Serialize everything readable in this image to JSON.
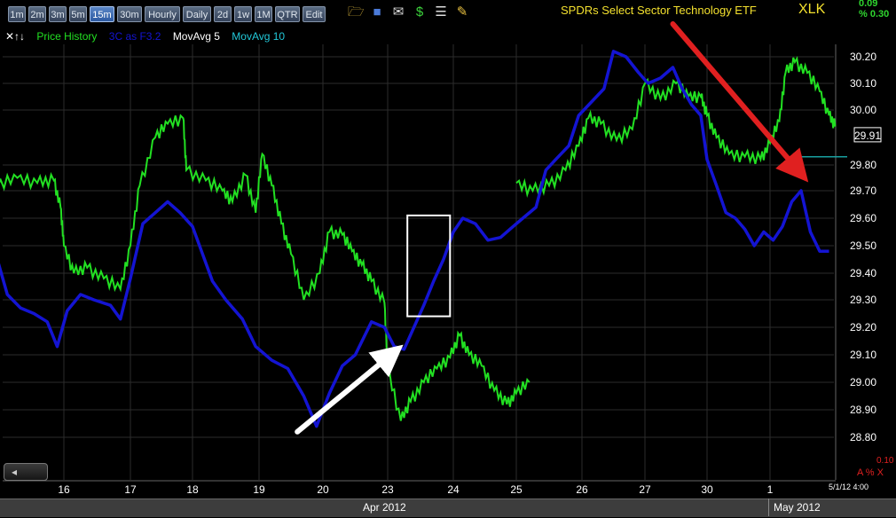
{
  "toolbar": {
    "timeframes": [
      "1m",
      "2m",
      "3m",
      "5m",
      "15m",
      "30m",
      "Hourly",
      "Daily",
      "2d",
      "1w",
      "1M",
      "QTR",
      "Edit"
    ],
    "active": "15m",
    "icons": [
      "folder-icon",
      "save-icon",
      "email-icon",
      "dollar-icon",
      "list-icon",
      "pencil-icon"
    ]
  },
  "header": {
    "title": "SPDRs Select Sector Technology ETF",
    "symbol": "XLK",
    "change_abs": "0.09",
    "change_pct": "% 0.30"
  },
  "legend": {
    "arrows": "✕↑↓",
    "items": [
      {
        "label": "Price History",
        "color": "#22e022"
      },
      {
        "label": "3C as F3.2",
        "color": "#1414d2"
      },
      {
        "label": "MovAvg 5",
        "color": "#ffffff"
      },
      {
        "label": "MovAvg 10",
        "color": "#22c8d8"
      }
    ]
  },
  "colors": {
    "price": "#22e022",
    "indicator": "#1414d2",
    "red_arrow": "#e02020",
    "white_arrow": "#ffffff",
    "grid": "#333333",
    "cyan_line": "#18a0a0"
  },
  "chart_data": {
    "type": "line",
    "title": "SPDRs Select Sector Technology ETF",
    "symbol": "XLK",
    "x_tick_labels": [
      "16",
      "17",
      "18",
      "19",
      "20",
      "23",
      "24",
      "25",
      "26",
      "27",
      "30",
      "1"
    ],
    "x_month_labels": [
      "Apr 2012",
      "May 2012"
    ],
    "y_tick_labels": [
      "30.20",
      "30.10",
      "30.00",
      "29.80",
      "29.70",
      "29.60",
      "29.50",
      "29.40",
      "29.30",
      "29.20",
      "29.10",
      "29.00",
      "28.90",
      "28.80"
    ],
    "ylim": [
      28.78,
      30.27
    ],
    "last_price": "29.91",
    "last_date": "5/1/12 4:00",
    "scale_value": "0.10",
    "scale_control": "A % X",
    "series": [
      {
        "name": "Price History",
        "color": "#22e022",
        "points": [
          [
            15.0,
            29.72
          ],
          [
            15.3,
            29.75
          ],
          [
            15.6,
            29.73
          ],
          [
            15.85,
            29.74
          ],
          [
            15.95,
            29.64
          ],
          [
            16.0,
            29.5
          ],
          [
            16.15,
            29.4
          ],
          [
            16.35,
            29.42
          ],
          [
            16.6,
            29.38
          ],
          [
            16.85,
            29.34
          ],
          [
            17.0,
            29.5
          ],
          [
            17.15,
            29.72
          ],
          [
            17.4,
            29.9
          ],
          [
            17.6,
            29.95
          ],
          [
            17.85,
            29.97
          ],
          [
            17.9,
            29.78
          ],
          [
            18.2,
            29.74
          ],
          [
            18.45,
            29.7
          ],
          [
            18.6,
            29.66
          ],
          [
            18.8,
            29.76
          ],
          [
            18.95,
            29.62
          ],
          [
            19.05,
            29.84
          ],
          [
            19.2,
            29.72
          ],
          [
            19.35,
            29.58
          ],
          [
            19.5,
            29.47
          ],
          [
            19.7,
            29.3
          ],
          [
            19.95,
            29.4
          ],
          [
            20.1,
            29.55
          ],
          [
            20.3,
            29.54
          ],
          [
            20.45,
            29.48
          ],
          [
            20.6,
            29.43
          ],
          [
            20.75,
            29.37
          ],
          [
            20.95,
            29.29
          ],
          [
            21.0,
            29.05
          ],
          [
            21.2,
            28.86
          ],
          [
            21.35,
            28.93
          ],
          [
            21.55,
            29.0
          ],
          [
            21.75,
            29.05
          ],
          [
            21.95,
            29.09
          ],
          [
            22.1,
            29.17
          ],
          [
            22.25,
            29.1
          ],
          [
            22.45,
            29.06
          ],
          [
            22.65,
            28.97
          ],
          [
            22.85,
            28.92
          ],
          [
            23.0,
            28.96
          ],
          [
            23.2,
            29.0
          ],
          [
            23.0,
            29.73
          ],
          [
            23.25,
            29.7
          ],
          [
            23.5,
            29.72
          ],
          [
            23.75,
            29.78
          ],
          [
            23.95,
            29.87
          ],
          [
            24.1,
            29.97
          ],
          [
            24.3,
            29.95
          ],
          [
            24.55,
            29.89
          ],
          [
            24.8,
            29.93
          ],
          [
            25.0,
            30.1
          ],
          [
            25.25,
            30.04
          ],
          [
            25.5,
            30.1
          ],
          [
            25.7,
            30.05
          ],
          [
            25.9,
            30.05
          ],
          [
            26.0,
            29.98
          ],
          [
            26.15,
            29.9
          ],
          [
            26.35,
            29.84
          ],
          [
            26.6,
            29.83
          ],
          [
            26.85,
            29.82
          ],
          [
            27.0,
            29.88
          ],
          [
            27.15,
            29.96
          ],
          [
            27.25,
            30.14
          ],
          [
            27.4,
            30.18
          ],
          [
            27.6,
            30.14
          ],
          [
            27.8,
            30.07
          ],
          [
            27.95,
            29.98
          ],
          [
            28.05,
            29.94
          ]
        ]
      },
      {
        "name": "3C as F3.2",
        "color": "#1414d2",
        "points": [
          [
            15.0,
            29.45
          ],
          [
            15.15,
            29.32
          ],
          [
            15.35,
            29.27
          ],
          [
            15.55,
            29.25
          ],
          [
            15.75,
            29.22
          ],
          [
            15.9,
            29.13
          ],
          [
            16.05,
            29.26
          ],
          [
            16.25,
            29.32
          ],
          [
            16.45,
            29.3
          ],
          [
            16.7,
            29.28
          ],
          [
            16.85,
            29.23
          ],
          [
            17.0,
            29.38
          ],
          [
            17.2,
            29.58
          ],
          [
            17.4,
            29.62
          ],
          [
            17.6,
            29.66
          ],
          [
            17.8,
            29.62
          ],
          [
            18.0,
            29.57
          ],
          [
            18.3,
            29.37
          ],
          [
            18.5,
            29.3
          ],
          [
            18.75,
            29.23
          ],
          [
            18.95,
            29.13
          ],
          [
            19.2,
            29.08
          ],
          [
            19.45,
            29.05
          ],
          [
            19.7,
            28.95
          ],
          [
            19.9,
            28.84
          ],
          [
            20.1,
            28.96
          ],
          [
            20.3,
            29.06
          ],
          [
            20.5,
            29.1
          ],
          [
            20.75,
            29.22
          ],
          [
            20.95,
            29.2
          ],
          [
            21.1,
            29.13
          ],
          [
            21.25,
            29.12
          ],
          [
            21.4,
            29.2
          ],
          [
            21.55,
            29.28
          ],
          [
            21.7,
            29.37
          ],
          [
            21.85,
            29.45
          ],
          [
            22.0,
            29.55
          ],
          [
            22.15,
            29.6
          ],
          [
            22.35,
            29.58
          ],
          [
            22.55,
            29.52
          ],
          [
            22.75,
            29.53
          ],
          [
            22.95,
            29.57
          ],
          [
            23.1,
            29.6
          ],
          [
            23.3,
            29.64
          ],
          [
            23.45,
            29.78
          ],
          [
            23.6,
            29.82
          ],
          [
            23.8,
            29.87
          ],
          [
            23.95,
            29.98
          ],
          [
            24.15,
            30.03
          ],
          [
            24.35,
            30.08
          ],
          [
            24.5,
            30.22
          ],
          [
            24.7,
            30.2
          ],
          [
            24.9,
            30.14
          ],
          [
            25.05,
            30.1
          ],
          [
            25.25,
            30.12
          ],
          [
            25.45,
            30.16
          ],
          [
            25.6,
            30.08
          ],
          [
            25.75,
            30.02
          ],
          [
            25.9,
            29.98
          ],
          [
            26.0,
            29.82
          ],
          [
            26.15,
            29.72
          ],
          [
            26.3,
            29.62
          ],
          [
            26.45,
            29.6
          ],
          [
            26.6,
            29.56
          ],
          [
            26.75,
            29.5
          ],
          [
            26.9,
            29.55
          ],
          [
            27.05,
            29.52
          ],
          [
            27.2,
            29.57
          ],
          [
            27.35,
            29.66
          ],
          [
            27.5,
            29.7
          ],
          [
            27.65,
            29.55
          ],
          [
            27.8,
            29.48
          ],
          [
            27.95,
            29.48
          ]
        ]
      }
    ],
    "annotations": [
      {
        "type": "arrow",
        "color": "#ffffff",
        "from": [
          19.6,
          28.82
        ],
        "to": [
          21.05,
          29.1
        ]
      },
      {
        "type": "arrow",
        "color": "#e02020",
        "from": [
          25.45,
          30.32
        ],
        "to": [
          27.45,
          29.78
        ]
      },
      {
        "type": "box",
        "color": "#ffffff",
        "x": [
          21.3,
          21.95
        ],
        "y": [
          29.24,
          29.61
        ]
      },
      {
        "type": "hline",
        "color": "#18a0a0",
        "y": 29.83,
        "x": [
          27.3,
          28.1
        ]
      }
    ]
  }
}
